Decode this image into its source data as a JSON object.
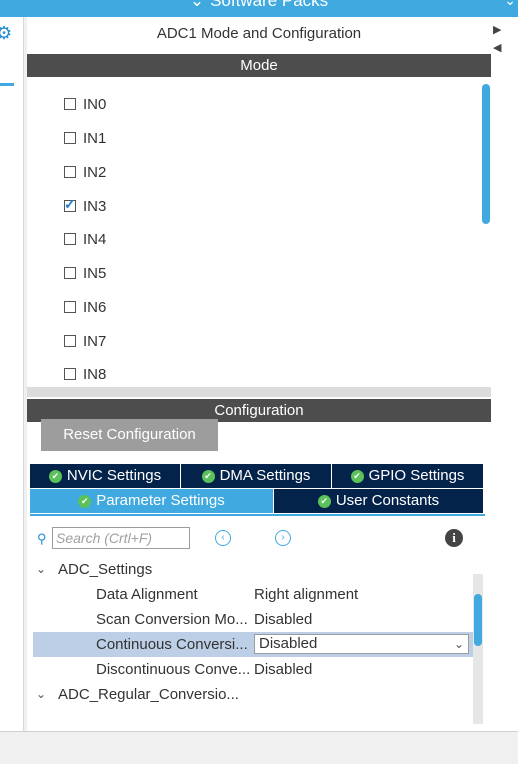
{
  "topbar": {
    "title": "Software Packs",
    "chevron": "⌄"
  },
  "panel": {
    "title": "ADC1 Mode and Configuration"
  },
  "mode": {
    "header": "Mode",
    "channels": [
      {
        "label": "IN0",
        "checked": false
      },
      {
        "label": "IN1",
        "checked": false
      },
      {
        "label": "IN2",
        "checked": false
      },
      {
        "label": "IN3",
        "checked": true
      },
      {
        "label": "IN4",
        "checked": false
      },
      {
        "label": "IN5",
        "checked": false
      },
      {
        "label": "IN6",
        "checked": false
      },
      {
        "label": "IN7",
        "checked": false
      },
      {
        "label": "IN8",
        "checked": false
      }
    ]
  },
  "configuration": {
    "header": "Configuration",
    "reset_label": "Reset Configuration",
    "tabs_row1": [
      "NVIC Settings",
      "DMA Settings",
      "GPIO Settings"
    ],
    "tabs_row2": [
      "Parameter Settings",
      "User Constants"
    ],
    "active_tab": "Parameter Settings",
    "search_placeholder": "Search (Crtl+F)",
    "tree": {
      "group1": "ADC_Settings",
      "params": [
        {
          "name": "Data Alignment",
          "value": "Right alignment"
        },
        {
          "name": "Scan Conversion Mo...",
          "value": "Disabled"
        },
        {
          "name": "Continuous Conversi...",
          "value": "Disabled"
        },
        {
          "name": "Discontinuous Conve...",
          "value": "Disabled"
        }
      ],
      "group2": "ADC_Regular_Conversio..."
    }
  },
  "icons": {
    "gear": "gear-icon",
    "search": "search-icon",
    "prev": "prev-match-icon",
    "next": "next-match-icon",
    "info": "info-icon",
    "check": "check-circle-icon"
  },
  "colors": {
    "accent": "#3fa9e0",
    "tab_dark": "#03234b",
    "header": "#4d4d4d",
    "ok": "#5bc25b",
    "selected_row": "#bccfe6"
  }
}
